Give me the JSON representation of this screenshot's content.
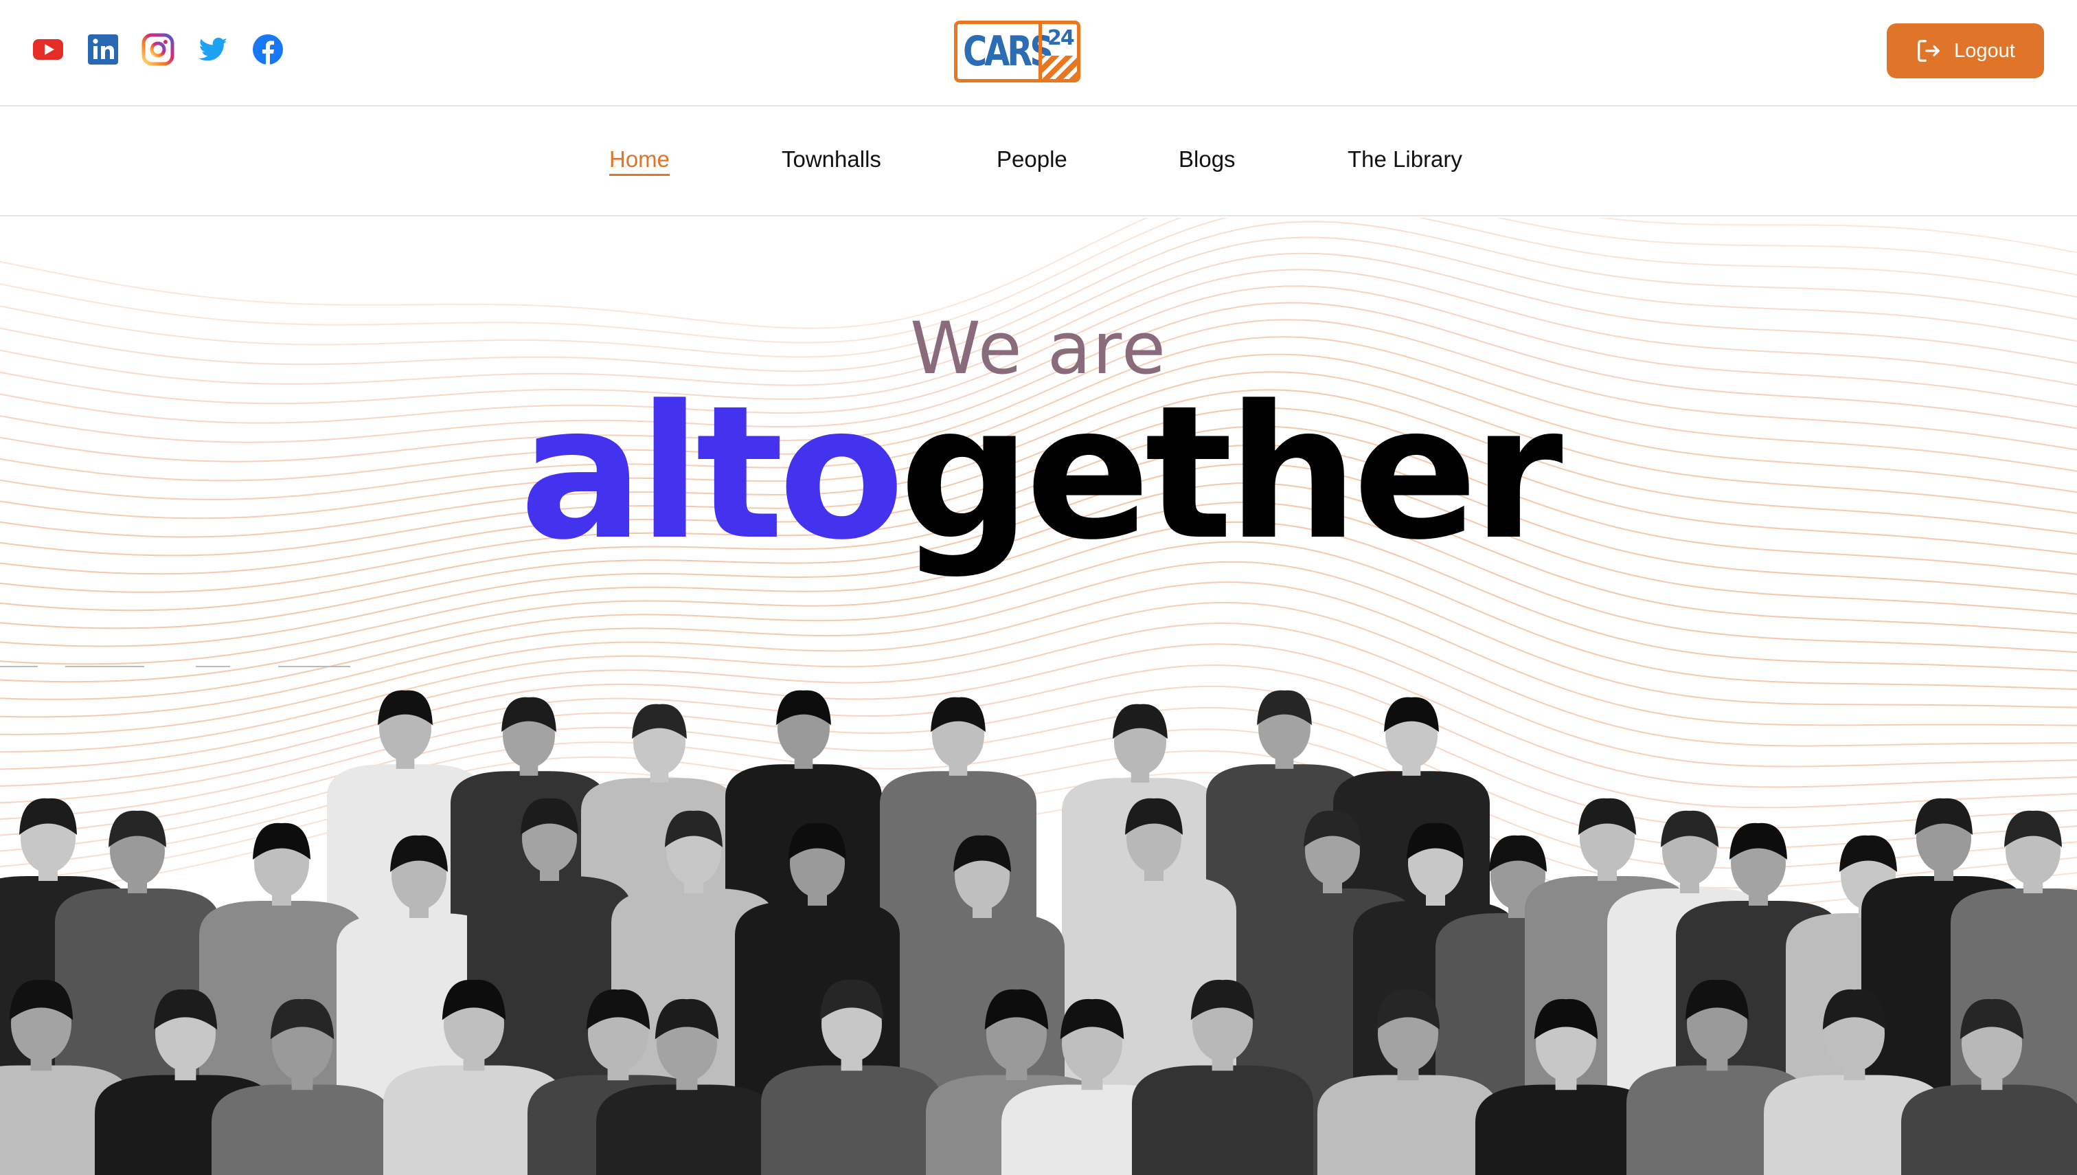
{
  "header": {
    "logo": {
      "text": "CARS",
      "number": "24"
    },
    "socials": [
      {
        "icon": "youtube-icon",
        "color": "#e52d27"
      },
      {
        "icon": "linkedin-icon",
        "color": "#2867b2"
      },
      {
        "icon": "instagram-icon",
        "color": "#c13584"
      },
      {
        "icon": "twitter-icon",
        "color": "#1da1f2"
      },
      {
        "icon": "facebook-icon",
        "color": "#1877f2"
      }
    ],
    "logout_label": "Logout"
  },
  "nav": {
    "items": [
      {
        "label": "Home",
        "active": true
      },
      {
        "label": "Townhalls",
        "active": false
      },
      {
        "label": "People",
        "active": false
      },
      {
        "label": "Blogs",
        "active": false
      },
      {
        "label": "The Library",
        "active": false
      }
    ]
  },
  "hero": {
    "subtitle": "We are",
    "title_accent": "alto",
    "title_rest": "gether"
  },
  "colors": {
    "accent": "#e07428",
    "hero_blue": "#4433ee",
    "wave": "#f0a070"
  },
  "team_photo": {
    "style": "grayscale group photo"
  }
}
